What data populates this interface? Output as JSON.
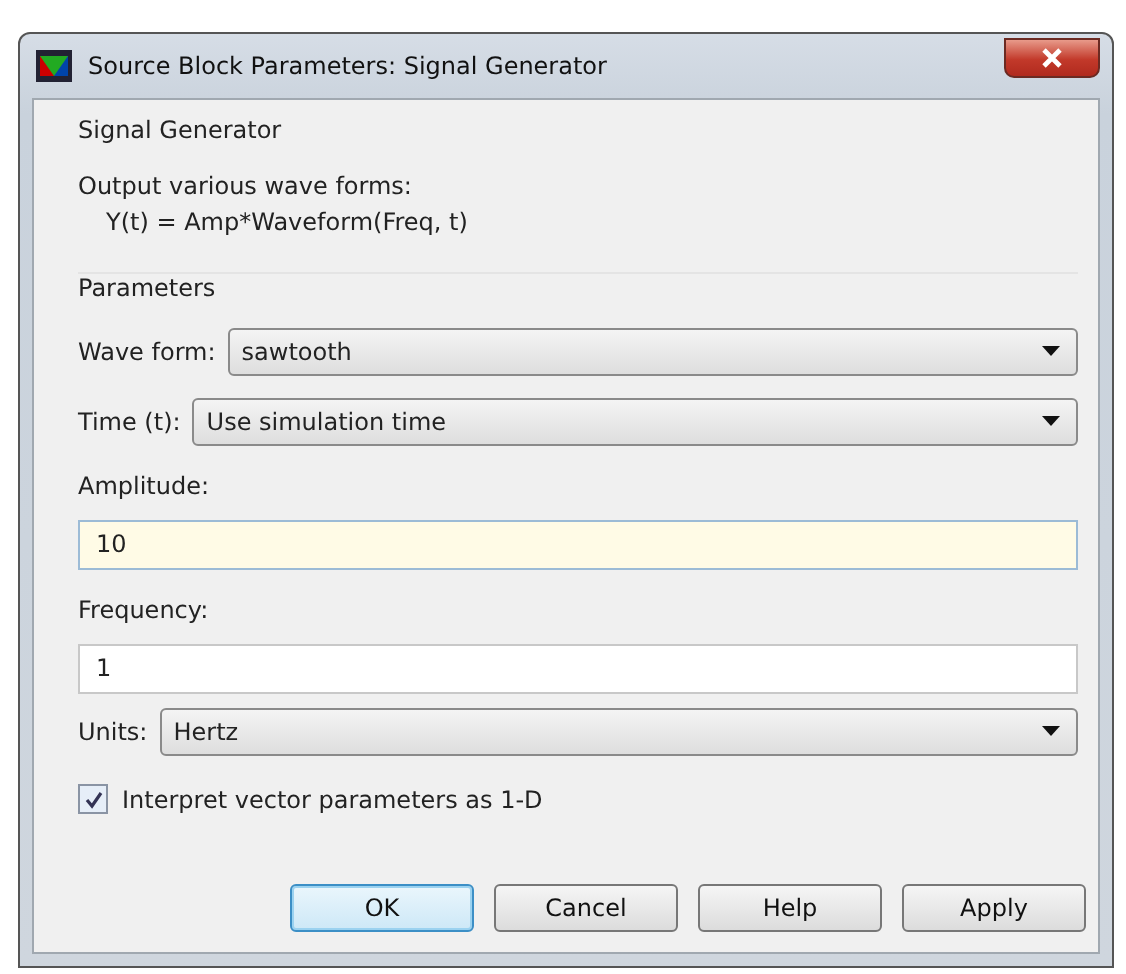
{
  "window": {
    "title": "Source Block Parameters: Signal Generator"
  },
  "block_name": "Signal Generator",
  "description": [
    "Output various wave forms:",
    "Y(t) = Amp*Waveform(Freq, t)"
  ],
  "section_title": "Parameters",
  "parameters": [
    {
      "kind": "dropdown",
      "label": "Wave form:",
      "value": "sawtooth"
    },
    {
      "kind": "dropdown",
      "label": "Time (t):",
      "value": "Use simulation time"
    },
    {
      "kind": "field",
      "label": "Amplitude:",
      "value": "10",
      "focused": true
    },
    {
      "kind": "field",
      "label": "Frequency:",
      "value": "1",
      "focused": false
    },
    {
      "kind": "dropdown",
      "label": "Units:",
      "value": "Hertz"
    },
    {
      "kind": "checkbox",
      "label": "Interpret vector parameters as 1-D",
      "checked": true
    }
  ],
  "buttons": [
    {
      "label": "OK",
      "default": true
    },
    {
      "label": "Cancel",
      "default": false
    },
    {
      "label": "Help",
      "default": false
    },
    {
      "label": "Apply",
      "default": false
    }
  ]
}
